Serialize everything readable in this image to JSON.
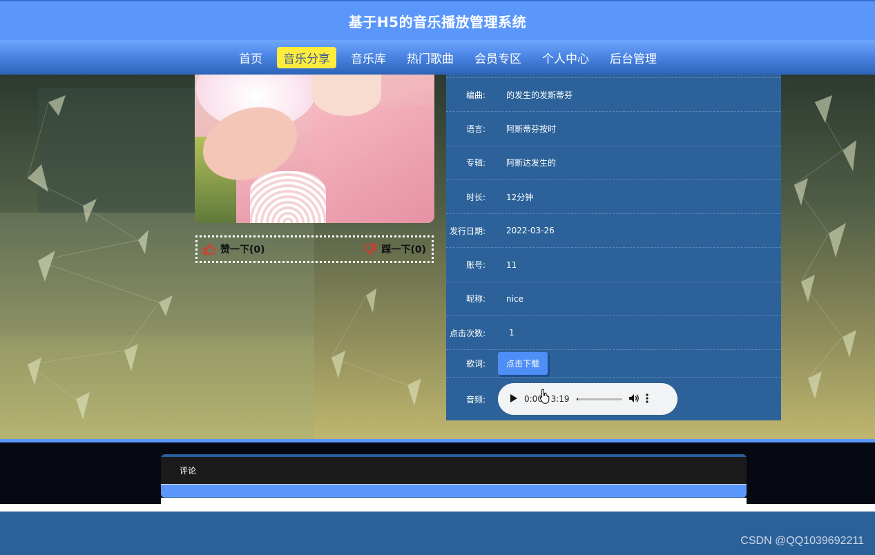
{
  "header": {
    "title": "基于H5的音乐播放管理系统"
  },
  "nav": {
    "items": [
      {
        "label": "首页",
        "active": false
      },
      {
        "label": "音乐分享",
        "active": true
      },
      {
        "label": "音乐库",
        "active": false
      },
      {
        "label": "热门歌曲",
        "active": false
      },
      {
        "label": "会员专区",
        "active": false
      },
      {
        "label": "个人中心",
        "active": false
      },
      {
        "label": "后台管理",
        "active": false
      }
    ],
    "active_color": "#ffec3d"
  },
  "vote": {
    "like_label": "赞一下(0)",
    "dislike_label": "踩一下(0)",
    "like_icon": "thumbs-up-icon",
    "dislike_icon": "thumbs-down-icon"
  },
  "details": {
    "composer_label": "编曲:",
    "composer_value": "的发生的发斯蒂芬",
    "language_label": "语言:",
    "language_value": "阿斯蒂芬按时",
    "album_label": "专辑:",
    "album_value": "阿斯达发生的",
    "duration_label": "时长:",
    "duration_value": "12分钟",
    "release_label": "发行日期:",
    "release_value": "2022-03-26",
    "account_label": "账号:",
    "account_value": "11",
    "nickname_label": "昵称:",
    "nickname_value": "nice",
    "clicks_label": "点击次数:",
    "clicks_value": "1",
    "lyrics_label": "歌词:",
    "lyrics_button": "点击下载",
    "audio_label": "音频:"
  },
  "audio": {
    "time": "0:00 / 3:19",
    "progress": 0
  },
  "comments": {
    "title": "评论"
  },
  "watermark": "CSDN @QQ1039692211",
  "colors": {
    "primary": "#5b97fb",
    "panel": "#2c6299"
  }
}
